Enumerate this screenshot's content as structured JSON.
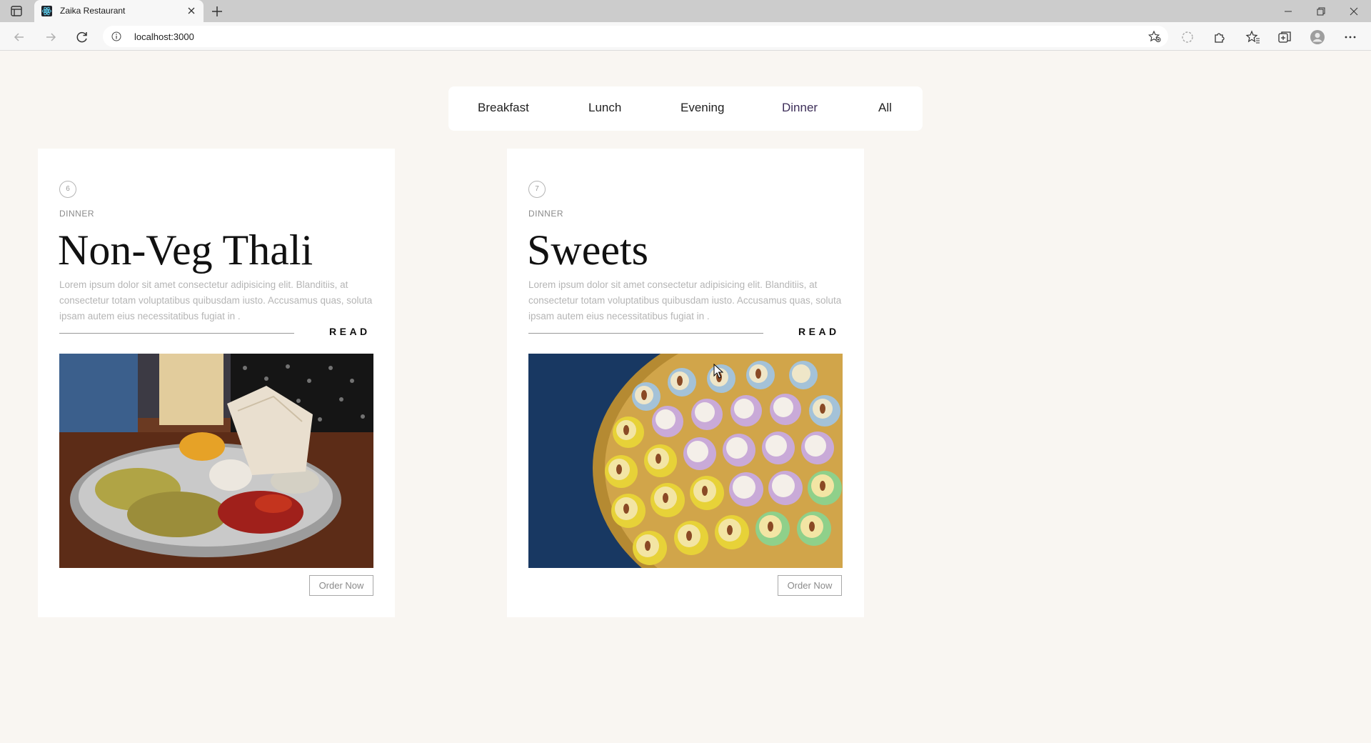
{
  "browser": {
    "tab_title": "Zaika Restaurant",
    "url": "localhost:3000"
  },
  "filters": {
    "items": [
      {
        "label": "Breakfast"
      },
      {
        "label": "Lunch"
      },
      {
        "label": "Evening"
      },
      {
        "label": "Dinner",
        "active": true
      },
      {
        "label": "All"
      }
    ]
  },
  "cards": [
    {
      "number": "6",
      "category": "DINNER",
      "title": "Non-Veg Thali",
      "description": "Lorem ipsum dolor sit amet consectetur adipisicing elit. Blanditiis, at consectetur totam voluptatibus quibusdam iusto. Accusamus quas, soluta ipsam autem eius necessitatibus fugiat in .",
      "read_label": "READ",
      "order_label": "Order Now"
    },
    {
      "number": "7",
      "category": "DINNER",
      "title": "Sweets",
      "description": "Lorem ipsum dolor sit amet consectetur adipisicing elit. Blanditiis, at consectetur totam voluptatibus quibusdam iusto. Accusamus quas, soluta ipsam autem eius necessitatibus fugiat in .",
      "read_label": "READ",
      "order_label": "Order Now"
    }
  ],
  "colors": {
    "page_background": "#f9f6f2",
    "card_background": "#ffffff",
    "active_filter": "#3d2e59"
  }
}
